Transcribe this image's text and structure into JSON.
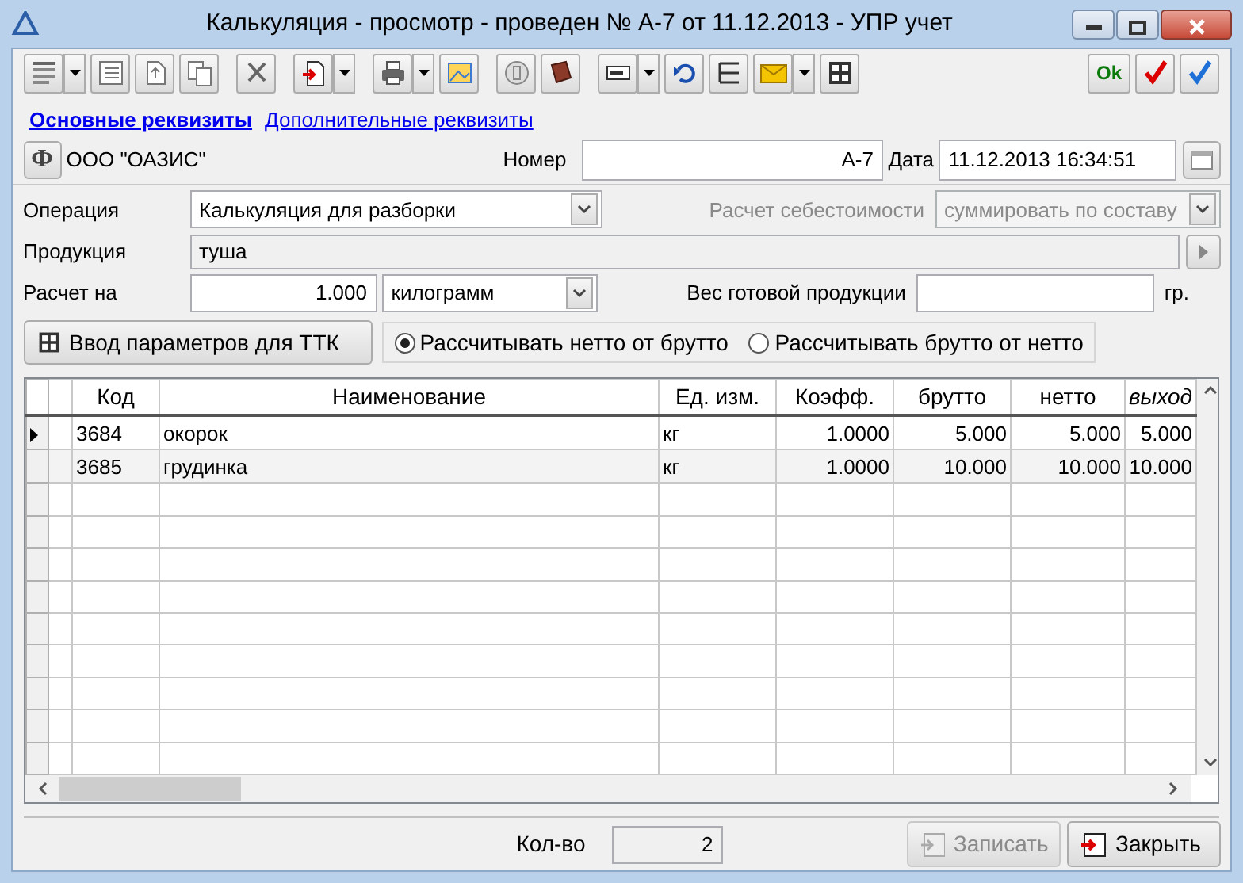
{
  "window": {
    "title": "Калькуляция - просмотр - проведен № А-7 от 11.12.2013 - УПР учет"
  },
  "toolbar": {
    "ok": "Ok"
  },
  "tabs": [
    {
      "label": "Основные реквизиты",
      "selected": true
    },
    {
      "label": "Дополнительные реквизиты",
      "selected": false
    }
  ],
  "header": {
    "org_button": "Ф",
    "org": "ООО \"ОАЗИС\"",
    "number_label": "Номер",
    "number": "А-7",
    "date_label": "Дата",
    "date": "11.12.2013 16:34:51"
  },
  "form": {
    "operation_label": "Операция",
    "operation": "Калькуляция для разборки",
    "cost_label": "Расчет себестоимости",
    "cost": "суммировать по составу",
    "cost_disabled": true,
    "product_label": "Продукция",
    "product": "туша",
    "calc_label": "Расчет на",
    "calc_qty": "1.000",
    "calc_unit": "килограмм",
    "weight_label": "Вес готовой продукции",
    "weight_unit": "гр."
  },
  "ttk_button": "Ввод параметров для ТТК",
  "radios": [
    {
      "label": "Рассчитывать нетто от брутто",
      "selected": true
    },
    {
      "label": "Рассчитывать брутто от нетто",
      "selected": false
    }
  ],
  "table": {
    "columns": [
      {
        "label": "Код",
        "kind": "text",
        "italic": false
      },
      {
        "label": "Наименование",
        "kind": "text",
        "italic": false
      },
      {
        "label": "Ед. изм.",
        "kind": "text",
        "italic": false
      },
      {
        "label": "Коэфф.",
        "kind": "number",
        "italic": false
      },
      {
        "label": "брутто",
        "kind": "number",
        "italic": false
      },
      {
        "label": "нетто",
        "kind": "number",
        "italic": false
      },
      {
        "label": "выход",
        "kind": "number",
        "italic": true
      }
    ],
    "rows": [
      {
        "current": true,
        "cells": [
          "3684",
          "окорок",
          "кг",
          "1.0000",
          "5.000",
          "5.000",
          "5.000"
        ]
      },
      {
        "current": false,
        "cells": [
          "3685",
          "грудинка",
          "кг",
          "1.0000",
          "10.000",
          "10.000",
          "10.000"
        ]
      }
    ]
  },
  "footer": {
    "count_label": "Кол-во",
    "count": "2",
    "buttons": [
      {
        "kind": "save",
        "label": "Записать",
        "disabled": true
      },
      {
        "kind": "close",
        "label": "Закрыть",
        "disabled": false
      }
    ]
  }
}
